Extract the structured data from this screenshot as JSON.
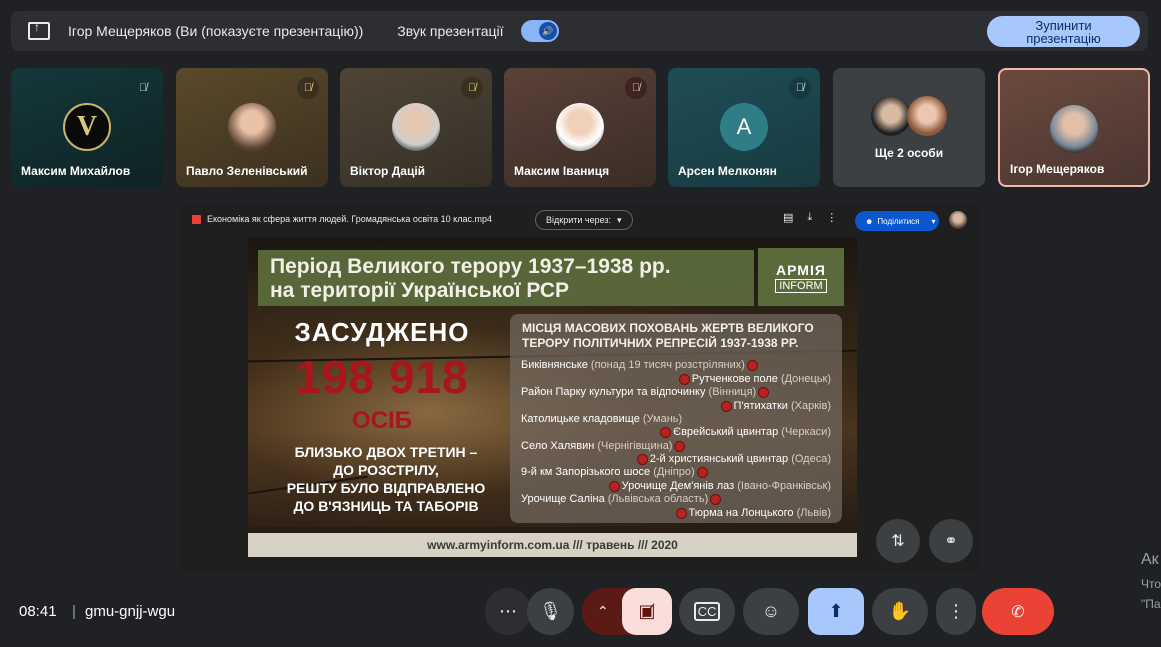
{
  "banner": {
    "presenter": "Ігор Мещеряков (Ви (показуєте презентацію))",
    "sound_label": "Звук презентації",
    "sound_on": true,
    "stop_button": "Зупинити презентацію"
  },
  "participants": [
    {
      "name": "Максим Михайлов",
      "muted": true
    },
    {
      "name": "Павло Зеленівський",
      "muted": true
    },
    {
      "name": "Віктор Дацій",
      "muted": true
    },
    {
      "name": "Максим Іваниця",
      "muted": true
    },
    {
      "name": "Арсен Мелконян",
      "muted": true,
      "initial": "A"
    },
    {
      "name": "Ще 2 особи"
    },
    {
      "name": "Ігор Мещеряков"
    }
  ],
  "drive": {
    "file_name": "Економіка як сфера життя людей. Громадянська освіта 10 клас.mp4",
    "open_with": "Відкрити через:",
    "share_label": "Поділитися"
  },
  "slide": {
    "title_line1": "Період Великого терору 1937–1938 рр.",
    "title_line2": "на території Української РСР",
    "logo_line1": "АРМІЯ",
    "logo_line2": "INFORM",
    "convicted": "ЗАСУДЖЕНО",
    "number": "198 918",
    "persons": "ОСІБ",
    "desc_line1": "БЛИЗЬКО ДВОХ ТРЕТИН –",
    "desc_line2": "ДО РОЗСТРІЛУ,",
    "desc_line3": "РЕШТУ БУЛО ВІДПРАВЛЕНО",
    "desc_line4": "ДО В'ЯЗНИЦЬ ТА ТАБОРІВ",
    "places_title_line1": "МІСЦЯ МАСОВИХ ПОХОВАНЬ ЖЕРТВ ВЕЛИКОГО",
    "places_title_line2": "ТЕРОРУ ПОЛІТИЧНИХ РЕПРЕСІЙ 1937-1938 РР.",
    "places": [
      {
        "name": "Биківнянське",
        "region": "(понад 19 тисяч розстріляних)"
      },
      {
        "name": "Рутченкове поле",
        "region": "(Донецьк)"
      },
      {
        "name": "Район Парку культури та відпочинку",
        "region": "(Вінниця)"
      },
      {
        "name": "П'ятихатки",
        "region": "(Харків)"
      },
      {
        "name": "Католицьке кладовище",
        "region": "(Умань)"
      },
      {
        "name": "Єврейський цвинтар",
        "region": "(Черкаси)"
      },
      {
        "name": "Село Халявин",
        "region": "(Чернігівщина)"
      },
      {
        "name": "2-й християнський цвинтар",
        "region": "(Одеса)"
      },
      {
        "name": "9-й км Запорізького шосе",
        "region": "(Дніпро)"
      },
      {
        "name": "Урочище Дем'янів лаз",
        "region": "(Івано-Франківськ)"
      },
      {
        "name": "Урочище Саліна",
        "region": "(Львівська область)"
      },
      {
        "name": "Тюрма на Лонцького",
        "region": "(Львів)"
      }
    ],
    "footer": "www.armyinform.com.ua  ///  травень  ///  2020"
  },
  "bottom": {
    "time": "08:41",
    "separator": "|",
    "meeting_code": "gmu-gnjj-wgu"
  },
  "side_text": {
    "line1": "Ак",
    "line2": "Что",
    "line3": "\"Па"
  },
  "colors": {
    "background": "#202124",
    "accent": "#a8c7fa",
    "end_call": "#ea4335",
    "camera_off": "#f9dedc"
  }
}
